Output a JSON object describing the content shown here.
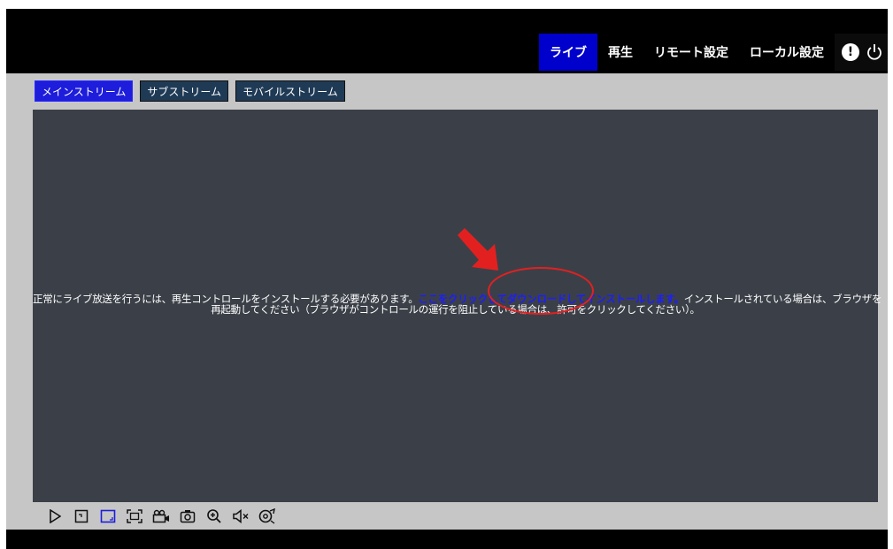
{
  "nav": {
    "items": [
      {
        "label": "ライブ",
        "active": true
      },
      {
        "label": "再生",
        "active": false
      },
      {
        "label": "リモート設定",
        "active": false
      },
      {
        "label": "ローカル設定",
        "active": false
      }
    ],
    "alert_icon": "alert-icon",
    "power_icon": "power-icon"
  },
  "tabs": [
    {
      "label": "メインストリーム",
      "active": true
    },
    {
      "label": "サブストリーム",
      "active": false
    },
    {
      "label": "モバイルストリーム",
      "active": false
    }
  ],
  "notice": {
    "prefix": "正常にライブ放送を行うには、再生コントロールをインストールする必要があります。",
    "link": "ここをクリックしてダウンロードしてインストールします。",
    "suffix": "インストールされている場合は、ブラウザを",
    "line2": "再起動してください（ブラウザがコントロールの運行を阻止している場合は、許可をクリックしてください）。"
  },
  "toolbar": {
    "buttons": [
      "play-icon",
      "layout-small-icon",
      "layout-fit-icon",
      "fullscreen-icon",
      "record-icon",
      "snapshot-icon",
      "zoom-in-icon",
      "mute-icon",
      "ptz-icon"
    ]
  },
  "colors": {
    "accent": "#0000cc",
    "link": "#1d1dff",
    "annotation": "#e32020",
    "video_bg": "#3b4048",
    "panel_bg": "#c6c6c6"
  }
}
